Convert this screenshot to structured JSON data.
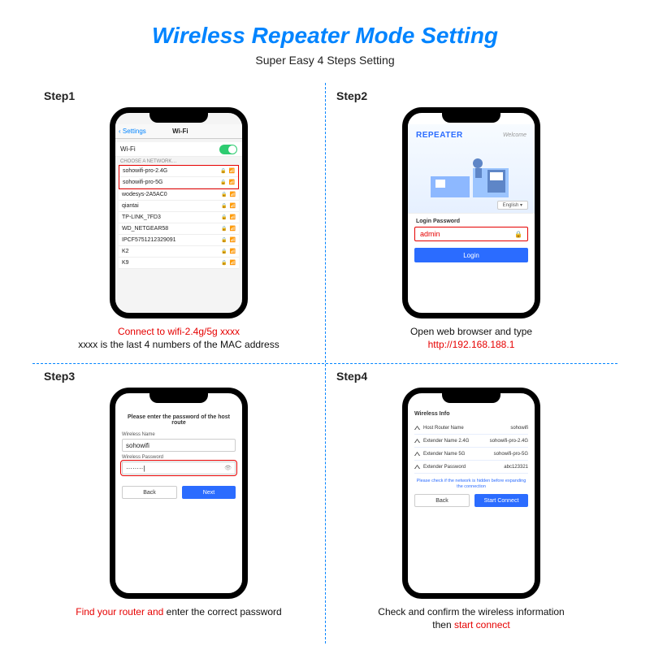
{
  "title": "Wireless Repeater Mode Setting",
  "subtitle": "Super Easy 4 Steps Setting",
  "steps_label": {
    "1": "Step1",
    "2": "Step2",
    "3": "Step3",
    "4": "Step4"
  },
  "step1": {
    "back": "Settings",
    "screen_title": "Wi-Fi",
    "wifi_label": "Wi-Fi",
    "section": "CHOOSE A NETWORK…",
    "hl": [
      "sohowifi-pro-2.4G",
      "sohowifi-pro-5G"
    ],
    "rows": [
      "wodesys-2A5AC0",
      "qiantai",
      "TP-LINK_7FD3",
      "WD_NETGEAR58",
      "IPCF5751212329091",
      "K2",
      "K9"
    ],
    "caption_red": "Connect to wifi-2.4g/5g xxxx",
    "caption_rest": "xxxx is the last 4 numbers of the MAC address"
  },
  "step2": {
    "brand": "REPEATER",
    "welcome": "Welcome",
    "lang": "English",
    "login_label": "Login Password",
    "login_value": "admin",
    "login_btn": "Login",
    "caption_black": "Open web browser and type",
    "caption_red": "http://192.168.188.1"
  },
  "step3": {
    "title": "Please enter the password of the host route",
    "name_label": "Wireless Name",
    "name_value": "sohowifi",
    "pw_label": "Wireless Password",
    "pw_value": "········|",
    "back": "Back",
    "next": "Next",
    "caption_red1": "Find your router and ",
    "caption_black": "enter the correct password"
  },
  "step4": {
    "head": "Wireless Info",
    "rows": [
      {
        "k": "Host Router Name",
        "v": "sohowifi"
      },
      {
        "k": "Extender Name 2.4G",
        "v": "sohowifi-pro-2.4G"
      },
      {
        "k": "Extender Name 5G",
        "v": "sohowifi-pro-5G"
      },
      {
        "k": "Extender Password",
        "v": "abc123321"
      }
    ],
    "note": "Please check if the network is hidden before expanding the connection",
    "back": "Back",
    "start": "Start Connect",
    "caption_black1": "Check and confirm the wireless information",
    "caption_black2": "then ",
    "caption_red": "start connect"
  }
}
